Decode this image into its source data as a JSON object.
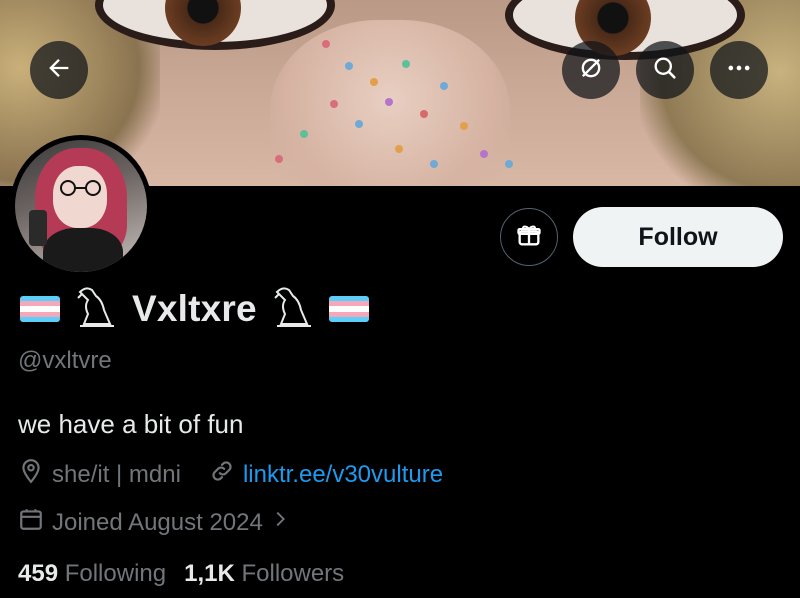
{
  "header": {
    "back_icon": "arrow-left-icon",
    "grok_icon": "grok-icon",
    "search_icon": "search-icon",
    "more_icon": "more-horizontal-icon"
  },
  "profile": {
    "display_name": "Vxltxre",
    "handle": "@vxltvre",
    "bio": "we have a bit of fun",
    "location": "she/it | mdni",
    "link": "linktr.ee/v30vulture",
    "joined": "Joined August 2024"
  },
  "actions": {
    "follow_label": "Follow",
    "gift_icon": "gift-icon"
  },
  "stats": {
    "following_count": "459",
    "following_label": "Following",
    "followers_count": "1,1K",
    "followers_label": "Followers"
  },
  "colors": {
    "accent": "#1d9bf0",
    "secondary_text": "#71767b",
    "primary_text": "#e7e9ea",
    "flag_blue": "#5bcefa",
    "flag_pink": "#f5a9b8",
    "flag_white": "#ffffff"
  }
}
